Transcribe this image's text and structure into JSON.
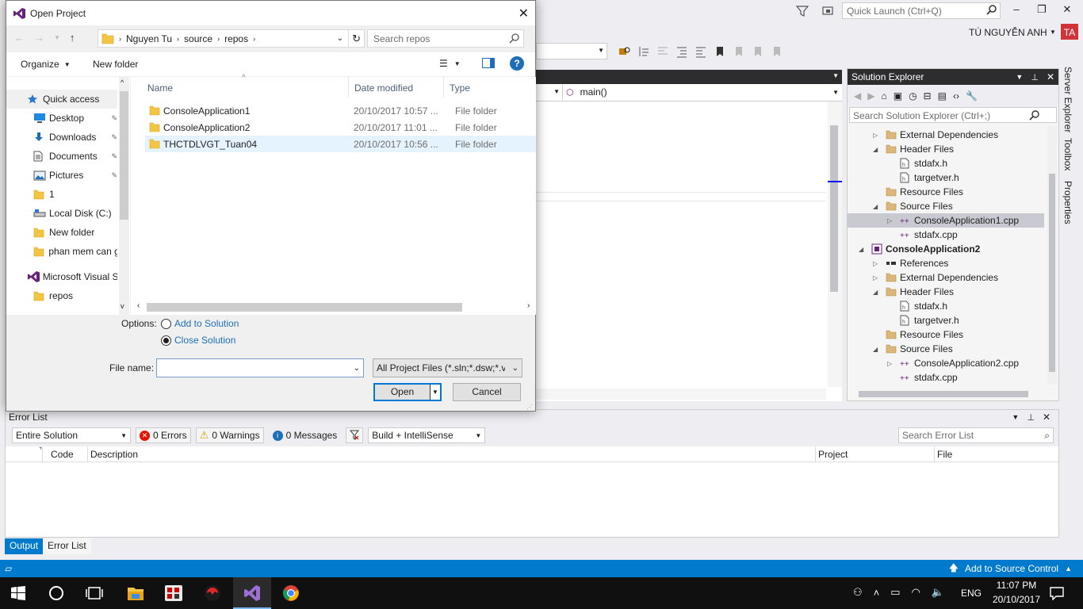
{
  "vs": {
    "quick_launch_placeholder": "Quick Launch (Ctrl+Q)",
    "user_name": "TÚ NGUYỄN ANH",
    "user_initials": "TA",
    "editor_function": "main()"
  },
  "dialog": {
    "title": "Open Project",
    "breadcrumb": [
      "Nguyen Tu",
      "source",
      "repos"
    ],
    "search_placeholder": "Search repos",
    "organize_label": "Organize",
    "new_folder_label": "New folder",
    "nav_items": [
      {
        "label": "Quick access",
        "icon": "star-icon"
      },
      {
        "label": "Desktop",
        "icon": "desktop-icon",
        "pinned": true
      },
      {
        "label": "Downloads",
        "icon": "download-icon",
        "pinned": true
      },
      {
        "label": "Documents",
        "icon": "document-icon",
        "pinned": true
      },
      {
        "label": "Pictures",
        "icon": "pictures-icon",
        "pinned": true
      },
      {
        "label": "1",
        "icon": "folder-icon"
      },
      {
        "label": "Local Disk (C:)",
        "icon": "drive-icon"
      },
      {
        "label": "New folder",
        "icon": "folder-icon"
      },
      {
        "label": "phan mem can g",
        "icon": "folder-icon"
      },
      {
        "label": "Microsoft Visual S",
        "icon": "vs-icon"
      },
      {
        "label": "repos",
        "icon": "folder-icon"
      }
    ],
    "columns": [
      "Name",
      "Date modified",
      "Type"
    ],
    "files": [
      {
        "name": "ConsoleApplication1",
        "date": "20/10/2017 10:57 ...",
        "type": "File folder"
      },
      {
        "name": "ConsoleApplication2",
        "date": "20/10/2017 11:01 ...",
        "type": "File folder"
      },
      {
        "name": "THCTDLVGT_Tuan04",
        "date": "20/10/2017 10:56 ...",
        "type": "File folder"
      }
    ],
    "options_label": "Options:",
    "option_add": "Add to Solution",
    "option_close": "Close Solution",
    "file_name_label": "File name:",
    "file_name_value": "",
    "filter_value": "All Project Files (*.sln;*.dsw;*.vc",
    "open_label": "Open",
    "cancel_label": "Cancel"
  },
  "solution_explorer": {
    "title": "Solution Explorer",
    "search_placeholder": "Search Solution Explorer (Ctrl+;)",
    "tree": [
      {
        "label": "External Dependencies",
        "depth": 1,
        "expander": "right",
        "icon": "folder-icon"
      },
      {
        "label": "Header Files",
        "depth": 1,
        "expander": "down",
        "icon": "folder-icon"
      },
      {
        "label": "stdafx.h",
        "depth": 2,
        "expander": "",
        "icon": "header-file-icon"
      },
      {
        "label": "targetver.h",
        "depth": 2,
        "expander": "",
        "icon": "header-file-icon"
      },
      {
        "label": "Resource Files",
        "depth": 1,
        "expander": "",
        "icon": "folder-icon"
      },
      {
        "label": "Source Files",
        "depth": 1,
        "expander": "down",
        "icon": "folder-icon"
      },
      {
        "label": "ConsoleApplication1.cpp",
        "depth": 2,
        "expander": "right",
        "icon": "cpp-file-icon",
        "selected": true
      },
      {
        "label": "stdafx.cpp",
        "depth": 2,
        "expander": "",
        "icon": "cpp-file-icon"
      },
      {
        "label": "ConsoleApplication2",
        "depth": 0,
        "expander": "down",
        "icon": "project-icon",
        "bold": true
      },
      {
        "label": "References",
        "depth": 1,
        "expander": "right",
        "icon": "references-icon"
      },
      {
        "label": "External Dependencies",
        "depth": 1,
        "expander": "right",
        "icon": "folder-icon"
      },
      {
        "label": "Header Files",
        "depth": 1,
        "expander": "down",
        "icon": "folder-icon"
      },
      {
        "label": "stdafx.h",
        "depth": 2,
        "expander": "",
        "icon": "header-file-icon"
      },
      {
        "label": "targetver.h",
        "depth": 2,
        "expander": "",
        "icon": "header-file-icon"
      },
      {
        "label": "Resource Files",
        "depth": 1,
        "expander": "",
        "icon": "folder-icon"
      },
      {
        "label": "Source Files",
        "depth": 1,
        "expander": "down",
        "icon": "folder-icon"
      },
      {
        "label": "ConsoleApplication2.cpp",
        "depth": 2,
        "expander": "right",
        "icon": "cpp-file-icon"
      },
      {
        "label": "stdafx.cpp",
        "depth": 2,
        "expander": "",
        "icon": "cpp-file-icon"
      }
    ]
  },
  "side_tabs": [
    "Server Explorer",
    "Toolbox",
    "Properties"
  ],
  "error_list": {
    "title": "Error List",
    "scope": "Entire Solution",
    "errors": "0 Errors",
    "warnings": "0 Warnings",
    "messages": "0 Messages",
    "build_filter": "Build + IntelliSense",
    "search_placeholder": "Search Error List",
    "columns": [
      "Code",
      "Description",
      "Project",
      "File"
    ]
  },
  "bottom_tabs": [
    "Output",
    "Error List"
  ],
  "status_bar": {
    "right": "Add to Source Control"
  },
  "taskbar": {
    "lang": "ENG",
    "time": "11:07 PM",
    "date": "20/10/2017"
  },
  "colors": {
    "accent": "#007acc",
    "vs_purple": "#68217a",
    "dark_header": "#2d2d30"
  }
}
